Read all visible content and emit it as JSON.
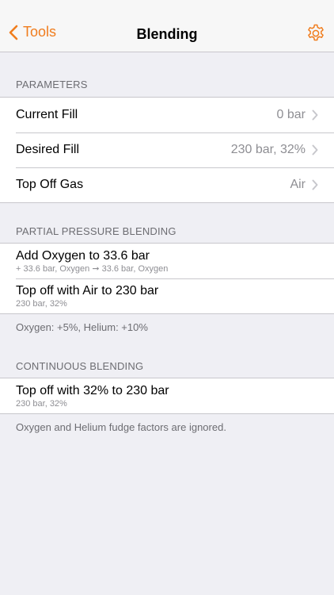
{
  "nav": {
    "back_label": "Tools",
    "title": "Blending",
    "accent": "#f07d1e"
  },
  "parameters": {
    "header": "Parameters",
    "rows": [
      {
        "label": "Current Fill",
        "value": "0 bar"
      },
      {
        "label": "Desired Fill",
        "value": "230 bar, 32%"
      },
      {
        "label": "Top Off Gas",
        "value": "Air"
      }
    ]
  },
  "partial": {
    "header": "Partial Pressure Blending",
    "rows": [
      {
        "label": "Add Oxygen to 33.6 bar",
        "detail": "+ 33.6 bar, Oxygen ➞ 33.6 bar, Oxygen"
      },
      {
        "label": "Top off with Air to 230 bar",
        "detail": "230 bar, 32%"
      }
    ],
    "footer": "Oxygen: +5%, Helium: +10%"
  },
  "continuous": {
    "header": "Continuous Blending",
    "rows": [
      {
        "label": "Top off with 32% to 230 bar",
        "detail": "230 bar, 32%"
      }
    ],
    "footer": "Oxygen and Helium fudge factors are ignored."
  }
}
